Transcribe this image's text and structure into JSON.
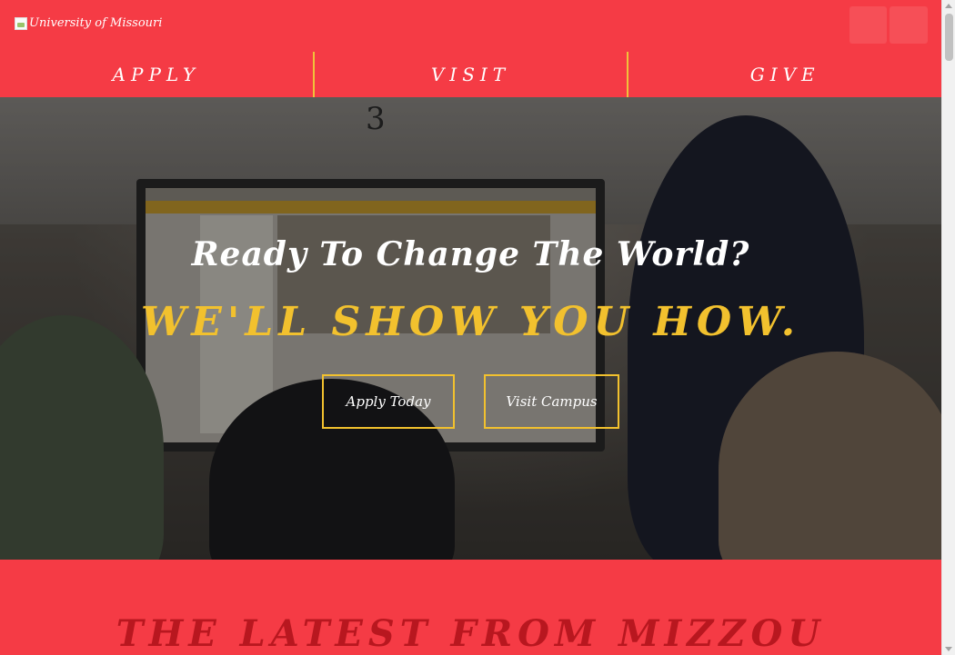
{
  "header": {
    "logo_alt": "University of Missouri",
    "icon_buttons": [
      "search-icon",
      "menu-icon"
    ]
  },
  "nav": {
    "items": [
      {
        "label": "APPLY"
      },
      {
        "label": "VISIT"
      },
      {
        "label": "GIVE"
      }
    ]
  },
  "hero": {
    "title": "Ready To Change The World?",
    "subtitle": "WE'LL SHOW YOU HOW.",
    "buttons": {
      "apply_label": "Apply Today",
      "visit_label": "Visit Campus"
    },
    "background_number": "3"
  },
  "latest": {
    "title": "THE LATEST FROM MIZZOU"
  },
  "colors": {
    "brand_red": "#f53b45",
    "accent_gold": "#f2c12e",
    "latest_title": "#b8171f"
  }
}
